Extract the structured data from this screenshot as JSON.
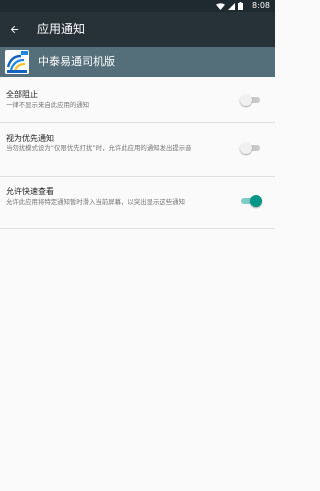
{
  "status_bar": {
    "time": "8:08",
    "icons": [
      "wifi-icon",
      "signal-icon",
      "battery-icon"
    ]
  },
  "toolbar": {
    "back_icon": "arrow-back-icon",
    "title": "应用通知"
  },
  "app": {
    "name": "中泰易通司机版",
    "icon": "app-logo-icon"
  },
  "settings": [
    {
      "title": "全部阻止",
      "summary": "一律不显示来自此应用的通知",
      "enabled": false
    },
    {
      "title": "视为优先通知",
      "summary": "当勿扰模式设为“仅限优先打扰”时，允许此应用的通知发出提示音",
      "enabled": false
    },
    {
      "title": "允许快速查看",
      "summary": "允许此应用将特定通知暂时滑入当前屏幕，以突出显示这些通知",
      "enabled": true
    }
  ],
  "colors": {
    "status_bar": "#1f2a30",
    "toolbar": "#263238",
    "app_header": "#546e7a",
    "accent": "#009688",
    "background": "#fafafa"
  }
}
